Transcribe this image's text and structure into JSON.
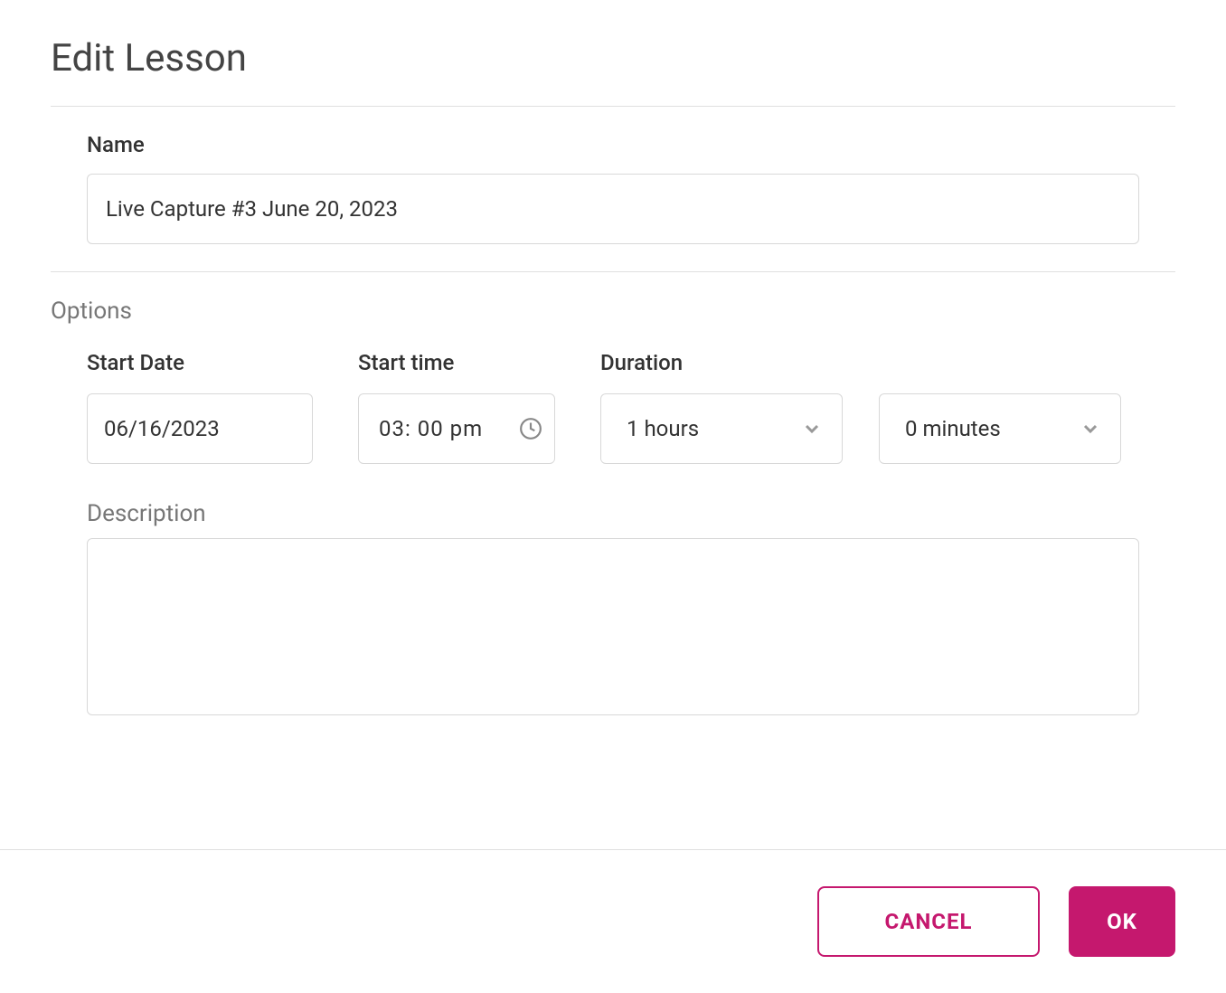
{
  "dialog": {
    "title": "Edit Lesson"
  },
  "form": {
    "name_label": "Name",
    "name_value": "Live Capture #3 June 20, 2023",
    "options_label": "Options",
    "start_date_label": "Start Date",
    "start_date_value": "06/16/2023",
    "start_time_label": "Start time",
    "start_time_value": "03: 00 pm",
    "duration_label": "Duration",
    "duration_hours": "1 hours",
    "duration_minutes": "0 minutes",
    "description_label": "Description",
    "description_value": ""
  },
  "buttons": {
    "cancel": "CANCEL",
    "ok": "OK"
  }
}
